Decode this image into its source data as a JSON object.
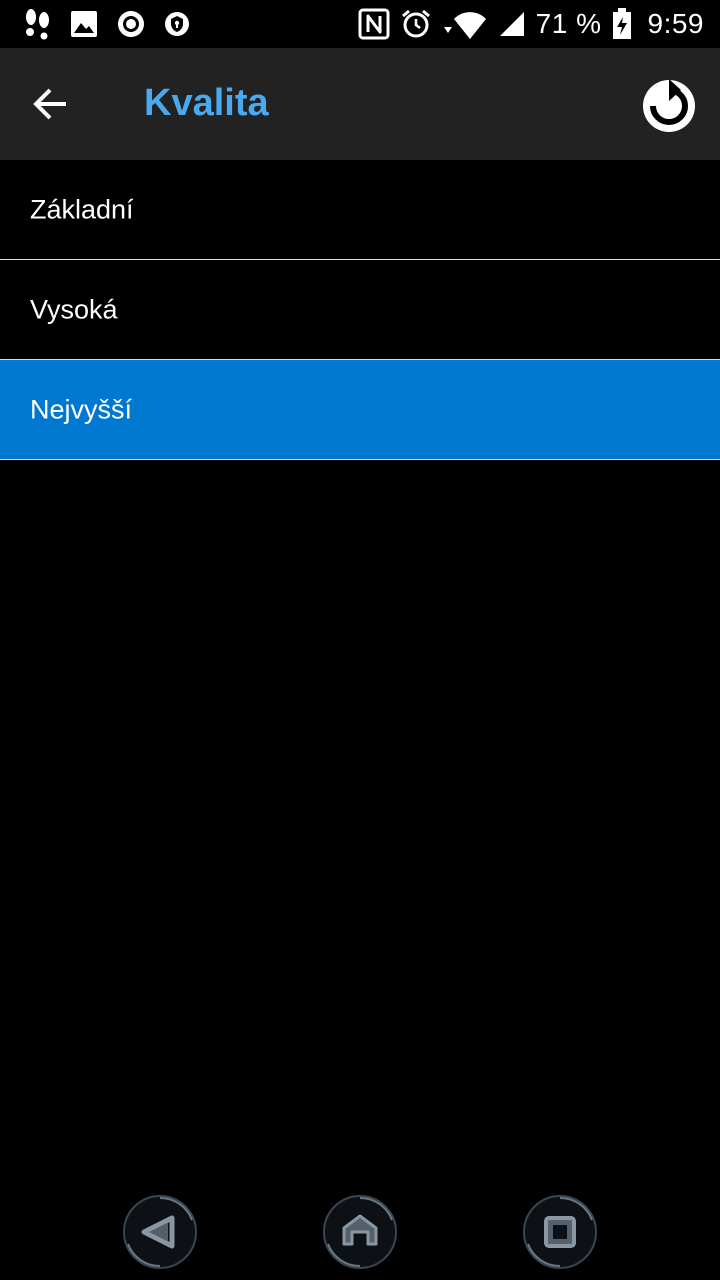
{
  "status_bar": {
    "battery": "71 %",
    "time": "9:59",
    "icons": [
      "footprints-icon",
      "image-icon",
      "record-icon",
      "shield-icon",
      "nfc-icon",
      "alarm-icon",
      "wifi-icon",
      "cell-signal-icon",
      "battery-charging-icon"
    ]
  },
  "toolbar": {
    "title": "Kvalita",
    "back_icon": "arrow-left-icon",
    "reset_icon": "refresh-icon",
    "title_color": "#4aa8ee"
  },
  "quality_options": [
    {
      "label": "Základní",
      "selected": false
    },
    {
      "label": "Vysoká",
      "selected": false
    },
    {
      "label": "Nejvyšší",
      "selected": true
    }
  ],
  "colors": {
    "selected_background": "#0078d0",
    "toolbar_background": "#222222",
    "background": "#000000"
  },
  "nav_bar": {
    "icons": [
      "nav-back-icon",
      "nav-home-icon",
      "nav-recents-icon"
    ]
  }
}
